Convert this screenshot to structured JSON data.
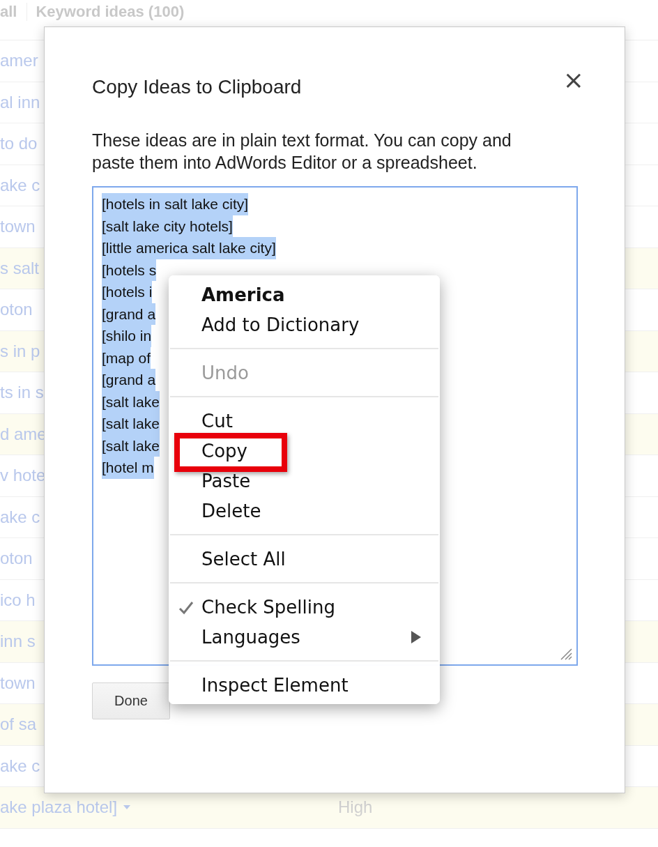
{
  "background": {
    "header": {
      "column_1": "all",
      "column_2": "Keyword ideas (100)"
    },
    "rows": [
      {
        "keyword": "amer",
        "highlighted": false,
        "caret": false
      },
      {
        "keyword": "al inn",
        "highlighted": false,
        "caret": false
      },
      {
        "keyword": "to do",
        "highlighted": false,
        "caret": false
      },
      {
        "keyword": "ake c",
        "highlighted": false,
        "caret": false
      },
      {
        "keyword": "town",
        "highlighted": false,
        "caret": false
      },
      {
        "keyword": "s salt",
        "highlighted": true,
        "caret": false
      },
      {
        "keyword": "oton",
        "highlighted": false,
        "caret": false
      },
      {
        "keyword": "s in p",
        "highlighted": true,
        "caret": false
      },
      {
        "keyword": "ts in s",
        "highlighted": false,
        "caret": false
      },
      {
        "keyword": "d ame",
        "highlighted": true,
        "caret": false
      },
      {
        "keyword": "v hote",
        "highlighted": false,
        "caret": false
      },
      {
        "keyword": "ake c",
        "highlighted": false,
        "caret": false
      },
      {
        "keyword": "oton",
        "highlighted": false,
        "caret": false
      },
      {
        "keyword": "ico h",
        "highlighted": false,
        "caret": false
      },
      {
        "keyword": "inn s",
        "highlighted": true,
        "caret": false
      },
      {
        "keyword": "town",
        "highlighted": false,
        "caret": false
      },
      {
        "keyword": "of sa",
        "highlighted": true,
        "caret": false
      },
      {
        "keyword": "ake c",
        "highlighted": false,
        "caret": false
      },
      {
        "keyword": "ake plaza hotel]",
        "highlighted": true,
        "caret": true,
        "competition": "High"
      }
    ]
  },
  "dialog": {
    "title": "Copy Ideas to Clipboard",
    "close": "×",
    "description": "These ideas are in plain text format. You can copy and paste them into AdWords Editor or a spreadsheet.",
    "lines": [
      {
        "text": "[hotels in salt lake city]",
        "selected": true
      },
      {
        "text": "[salt lake city hotels]",
        "selected": true
      },
      {
        "text": "[little america salt lake city]",
        "selected": true
      },
      {
        "text": "[hotels s",
        "selected": true
      },
      {
        "text": "[hotels i",
        "selected": true
      },
      {
        "text": "[grand a",
        "selected": true
      },
      {
        "text": "[shilo in",
        "selected": true
      },
      {
        "text": "[map of",
        "selected": true
      },
      {
        "text": "[grand a",
        "selected": true
      },
      {
        "text": "[salt lake",
        "selected": true
      },
      {
        "text": "[salt lake",
        "selected": true
      },
      {
        "text": "[salt lake",
        "selected": true
      },
      {
        "text": "[hotel m",
        "selected": true
      }
    ],
    "done_button": "Done"
  },
  "context_menu": {
    "sections": [
      [
        {
          "label": "America",
          "kind": "suggestion",
          "disabled": false,
          "checked": false,
          "submenu": false
        },
        {
          "label": "Add to Dictionary",
          "kind": "command",
          "disabled": false,
          "checked": false,
          "submenu": false
        }
      ],
      [
        {
          "label": "Undo",
          "kind": "command",
          "disabled": true,
          "checked": false,
          "submenu": false
        }
      ],
      [
        {
          "label": "Cut",
          "kind": "command",
          "disabled": false,
          "checked": false,
          "submenu": false
        },
        {
          "label": "Copy",
          "kind": "command",
          "disabled": false,
          "checked": false,
          "submenu": false
        },
        {
          "label": "Paste",
          "kind": "command",
          "disabled": false,
          "checked": false,
          "submenu": false
        },
        {
          "label": "Delete",
          "kind": "command",
          "disabled": false,
          "checked": false,
          "submenu": false
        }
      ],
      [
        {
          "label": "Select All",
          "kind": "command",
          "disabled": false,
          "checked": false,
          "submenu": false
        }
      ],
      [
        {
          "label": "Check Spelling",
          "kind": "command",
          "disabled": false,
          "checked": true,
          "submenu": false
        },
        {
          "label": "Languages",
          "kind": "command",
          "disabled": false,
          "checked": false,
          "submenu": true
        }
      ],
      [
        {
          "label": "Inspect Element",
          "kind": "command",
          "disabled": false,
          "checked": false,
          "submenu": false
        }
      ]
    ]
  }
}
